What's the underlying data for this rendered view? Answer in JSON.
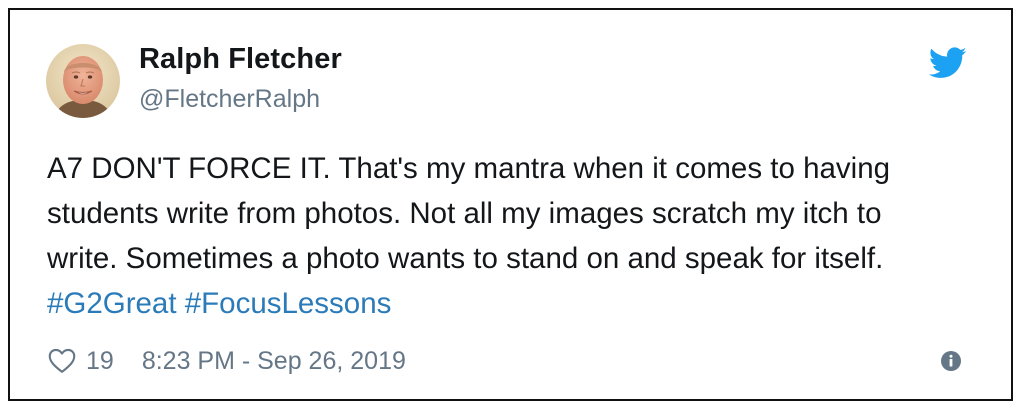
{
  "author": {
    "display_name": "Ralph Fletcher",
    "handle": "@FletcherRalph"
  },
  "tweet": {
    "lines": [
      "A7 DON'T FORCE IT. That's my mantra when it comes to having",
      "students write from photos. Not all my images scratch my itch to",
      "write. Sometimes a photo wants to stand on and speak for itself."
    ],
    "hashtags": [
      "#G2Great",
      "#FocusLessons"
    ]
  },
  "footer": {
    "like_count": "19",
    "timestamp": "8:23 PM - Sep 26, 2019"
  },
  "icons": {
    "logo": "twitter-bird-icon",
    "like": "heart-icon",
    "info": "info-icon"
  },
  "colors": {
    "brand": "#1da1f2",
    "link": "#2b7bb9",
    "text": "#14171a",
    "muted": "#657786"
  }
}
